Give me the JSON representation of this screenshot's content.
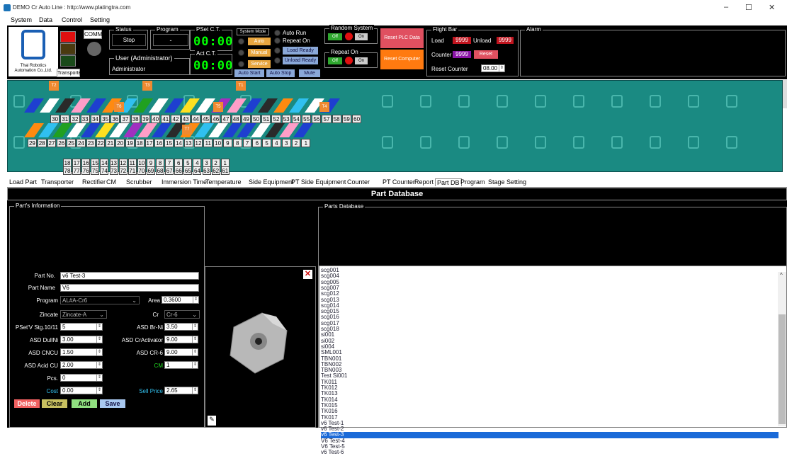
{
  "window": {
    "title": "DEMO Cr Auto Line : http://www.platingtra.com",
    "min": "–",
    "max": "☐",
    "close": "✕"
  },
  "menu": [
    "System",
    "Data",
    "Control",
    "Setting"
  ],
  "top": {
    "logo_text": "Thai Robotics Automation Co.,Ltd.",
    "comm": "COMM",
    "transporter": "Transporter",
    "status_label": "Status",
    "status_value": "Stop",
    "program_label": "Program",
    "program_value": "-",
    "user_label": "User (Administrator)",
    "user_value": "Administrator",
    "pset_label": "PSet C.T.",
    "pset_value": "00:00",
    "act_label": "Act C.T.",
    "act_value": "00:00",
    "sysmode_label": "System Mode",
    "auto": "Auto",
    "manual": "Manual",
    "service": "Service",
    "auto_run": "Auto Run",
    "repeat_on": "Repeat On",
    "load_ready": "Load Ready",
    "unload_ready": "Unload Ready",
    "auto_start": "Auto Start",
    "auto_stop": "Auto Stop",
    "mute": "Mute",
    "random_label": "Random System",
    "off": "Off",
    "on": "On",
    "repeat_label": "Repeat On",
    "reset_plc": "Reset PLC Data",
    "reset_computer": "Reset Computer",
    "flight_label": "Flight Bar",
    "load": "Load",
    "load_val": "9999",
    "unload": "Unload",
    "unload_val": "9999",
    "counter": "Counter",
    "counter_val": "9999",
    "reset": "Reset",
    "reset_counter": "Reset Counter",
    "reset_counter_val": "08.00",
    "alarm_label": "Alarm"
  },
  "tank": {
    "row1": [
      "30",
      "31",
      "32",
      "33",
      "34",
      "35",
      "36",
      "37",
      "38",
      "39",
      "40",
      "41",
      "42",
      "43",
      "44",
      "45",
      "46",
      "47",
      "48",
      "49",
      "50",
      "51",
      "52",
      "53",
      "54",
      "55",
      "56",
      "57",
      "58",
      "59",
      "60"
    ],
    "row2": [
      "29",
      "28",
      "27",
      "26",
      "25",
      "24",
      "23",
      "22",
      "21",
      "20",
      "19",
      "18",
      "17",
      "16",
      "15",
      "14",
      "13",
      "12",
      "11",
      "10",
      "9",
      "8",
      "7",
      "6",
      "5",
      "4",
      "3",
      "2",
      "1"
    ],
    "row3": [
      "18",
      "17",
      "16",
      "15",
      "14",
      "13",
      "12",
      "11",
      "10",
      "9",
      "8",
      "7",
      "6",
      "5",
      "4",
      "3",
      "2",
      "1"
    ],
    "row4": [
      "78",
      "77",
      "76",
      "75",
      "74",
      "73",
      "72",
      "71",
      "70",
      "69",
      "68",
      "67",
      "66",
      "65",
      "64",
      "63",
      "62",
      "61"
    ],
    "cranes": [
      "T2",
      "T3",
      "T1",
      "T6",
      "T5",
      "T4",
      "T7"
    ]
  },
  "tabs": [
    "Load Part",
    "Transporter",
    "Rectifier",
    "CM",
    "Scrubber",
    "Immersion Time",
    "Temperature",
    "Side Equipment",
    "PT Side Equipment",
    "Counter",
    "PT Counter",
    "Report",
    "Part DB",
    "Program",
    "Stage Setting"
  ],
  "header": "Part Database",
  "info": {
    "legend": "Part's Information",
    "part_no_l": "Part No.",
    "part_no": "v6 Test-3",
    "part_name_l": "Part Name",
    "part_name": "V6",
    "program_l": "Program",
    "program": "AL#A-Cr6",
    "area_l": "Area",
    "area": "0.3600",
    "zincate_l": "Zincate",
    "zincate": "Zincate-A",
    "cr_l": "Cr",
    "cr": "Cr-6",
    "pset_l": "PSet'V Stg.10/11",
    "pset": "5",
    "brni_l": "ASD Br-Ni",
    "brni": "3.50",
    "dullni_l": "ASD DullNi",
    "dullni": "3.00",
    "cract_l": "ASD CrActivator",
    "cract": "9.00",
    "cncu_l": "ASD CNCU",
    "cncu": "1.50",
    "cr6_l": "ASD CR-6",
    "cr6": "9.00",
    "acid_l": "ASD Acid CU",
    "acid": "2.00",
    "cm_l": "CM",
    "cm": "1",
    "pcs_l": "Pcs.",
    "pcs": "0",
    "cost_l": "Cost",
    "cost": "0.00",
    "sell_l": "Sell Price",
    "sell": "2.65",
    "delete": "Delete",
    "clear": "Clear",
    "add": "Add",
    "save": "Save"
  },
  "list": {
    "legend": "Parts Database",
    "items": [
      "scg001",
      "scg004",
      "scg005",
      "scg007",
      "scg012",
      "scg013",
      "scg014",
      "scg015",
      "scg016",
      "scg017",
      "scg018",
      "si001",
      "si002",
      "si004",
      "SML001",
      "TBN001",
      "TBN002",
      "TBN003",
      "Test Si001",
      "TK011",
      "TK012",
      "TK013",
      "TK014",
      "TK015",
      "TK016",
      "TK017",
      "v6 Test-1",
      "v6 Test-2",
      "v6 Test-3",
      "V6 Test-4",
      "V6 Test-5",
      "v6 Test-6"
    ],
    "selected": "v6 Test-3"
  },
  "colors": {
    "teal": "#1a8a82",
    "cyan": "#32c2f0",
    "select": "#1a6ad8",
    "seg": "#00ff00"
  }
}
